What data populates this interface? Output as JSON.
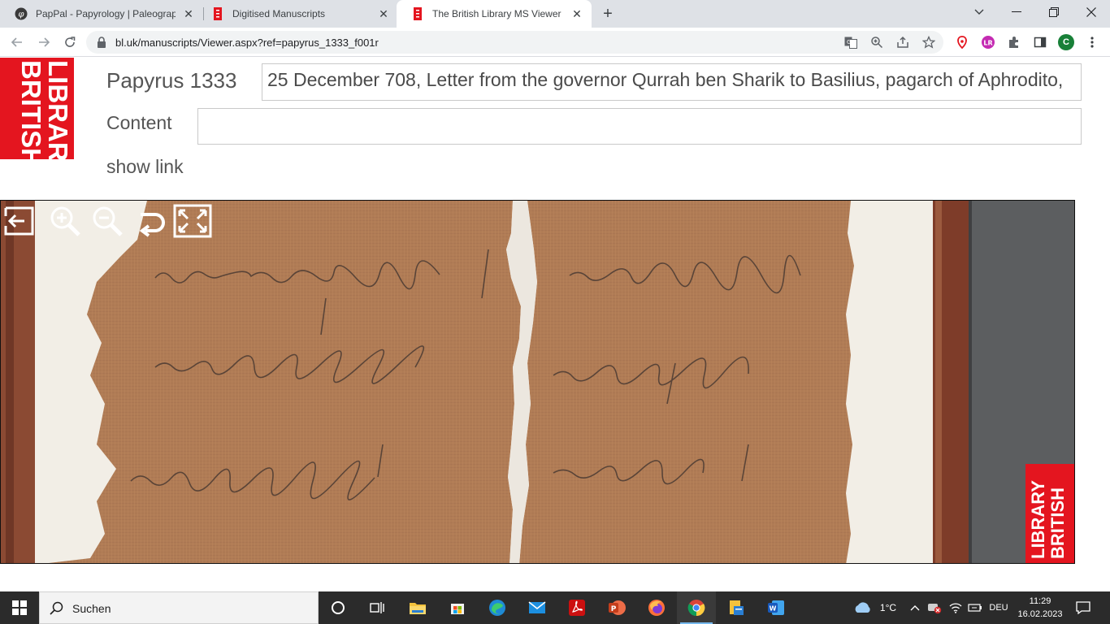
{
  "browser": {
    "tabs": [
      {
        "title": "PapPal - Papyrology | Paleography",
        "active": false,
        "icon": "pappal-favicon"
      },
      {
        "title": "Digitised Manuscripts",
        "active": false,
        "icon": "british-library-favicon"
      },
      {
        "title": "The British Library MS Viewer",
        "active": true,
        "icon": "british-library-favicon"
      }
    ],
    "new_tab_icon": "plus-icon",
    "address": "bl.uk/manuscripts/Viewer.aspx?ref=papyrus_1333_f001r",
    "profile_initial": "C",
    "colors": {
      "tabstrip": "#dee1e6",
      "omnibox": "#f1f3f4",
      "profile": "#188038"
    }
  },
  "page": {
    "logo_lines": [
      "BRITISH",
      "LIBRARY"
    ],
    "title_label": "Papyrus 1333",
    "title_value": "25 December 708, Letter from the governor Qurrah ben Sharik to Basilius, pagarch of Aphrodito,",
    "content_label": "Content",
    "content_value": "",
    "show_link": "show link",
    "brand_color": "#e4151f"
  },
  "viewer": {
    "controls": [
      "exit-icon",
      "zoom-in-icon",
      "zoom-out-icon",
      "rotate-icon",
      "fullscreen-icon"
    ],
    "badge_lines": [
      "BRITISH",
      "LIBRARY"
    ]
  },
  "taskbar": {
    "search_placeholder": "Suchen",
    "weather": "1°C",
    "language": "DEU",
    "time": "11:29",
    "date": "16.02.2023"
  }
}
